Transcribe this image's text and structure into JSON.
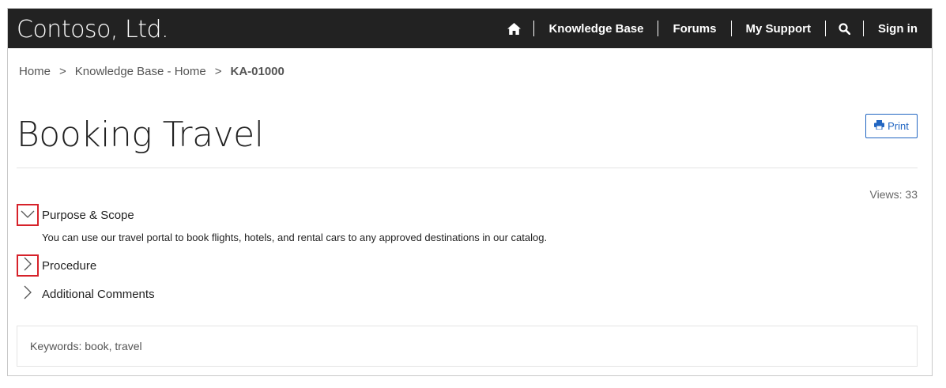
{
  "brand": {
    "name": "Contoso, Ltd."
  },
  "nav": {
    "home_icon": "home-icon",
    "items": [
      {
        "label": "Knowledge Base"
      },
      {
        "label": "Forums"
      },
      {
        "label": "My Support"
      }
    ],
    "search_icon": "search-icon",
    "sign_in": "Sign in"
  },
  "breadcrumb": {
    "items": [
      "Home",
      "Knowledge Base - Home"
    ],
    "separator": ">",
    "current": "KA-01000"
  },
  "article": {
    "title": "Booking Travel",
    "print_label": "Print",
    "print_icon": "printer-icon",
    "views": "Views: 33",
    "sections": [
      {
        "label": "Purpose & Scope",
        "expanded": true,
        "body": "You can use our travel portal to book flights, hotels, and rental cars to any approved destinations in our catalog."
      },
      {
        "label": "Procedure",
        "expanded": false
      },
      {
        "label": "Additional Comments",
        "expanded": false
      }
    ],
    "keywords": "Keywords: book, travel"
  },
  "colors": {
    "navbar_bg": "#222222",
    "accent": "#2266c2",
    "highlight_box": "#d6222a"
  }
}
